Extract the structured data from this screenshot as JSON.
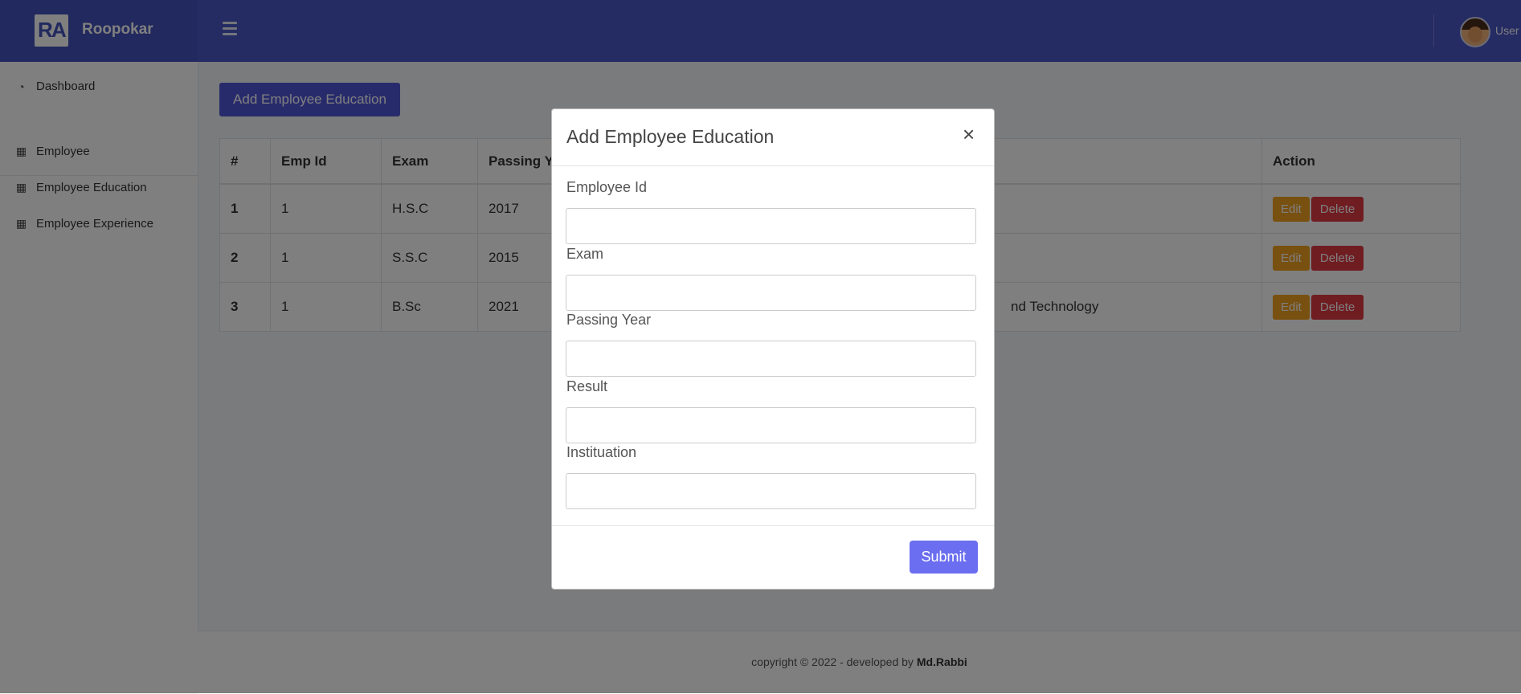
{
  "brand": {
    "logo_left": "R",
    "logo_right": "A",
    "name": "Roopokar"
  },
  "header": {
    "menu_icon": "hamburger-icon",
    "user_label": "User",
    "avatar_icon": "user-avatar"
  },
  "sidebar": {
    "items": [
      {
        "label": "Dashboard",
        "icon": "dashboard-gauge-icon"
      },
      {
        "label": "Employee",
        "icon": "table-icon"
      },
      {
        "label": "Employee Education",
        "icon": "table-icon"
      },
      {
        "label": "Employee Experience",
        "icon": "table-icon"
      }
    ]
  },
  "main": {
    "add_button": "Add Employee Education",
    "table": {
      "headers": [
        "#",
        "Emp Id",
        "Exam",
        "Passing Ye",
        "",
        "Action"
      ],
      "rows": [
        {
          "idx": "1",
          "emp_id": "1",
          "exam": "H.S.C",
          "year": "2017",
          "inst": "",
          "edit": "Edit",
          "delete": "Delete"
        },
        {
          "idx": "2",
          "emp_id": "1",
          "exam": "S.S.C",
          "year": "2015",
          "inst": "",
          "edit": "Edit",
          "delete": "Delete"
        },
        {
          "idx": "3",
          "emp_id": "1",
          "exam": "B.Sc",
          "year": "2021",
          "inst": "nd Technology",
          "edit": "Edit",
          "delete": "Delete"
        }
      ]
    }
  },
  "footer": {
    "text": "copyright © 2022 - developed by",
    "author": "Md.Rabbi"
  },
  "modal": {
    "title": "Add Employee Education",
    "close": "×",
    "fields": [
      {
        "label": "Employee Id",
        "value": "",
        "placeholder": ""
      },
      {
        "label": "Exam",
        "value": "",
        "placeholder": ""
      },
      {
        "label": "Passing Year",
        "value": "",
        "placeholder": ""
      },
      {
        "label": "Result",
        "value": "",
        "placeholder": ""
      },
      {
        "label": "Instituation",
        "value": "",
        "placeholder": ""
      }
    ],
    "submit": "Submit"
  },
  "colors": {
    "accent": "#4a56c6",
    "primary_button": "#5057d6",
    "edit": "#f0a020",
    "delete": "#e03a45"
  }
}
